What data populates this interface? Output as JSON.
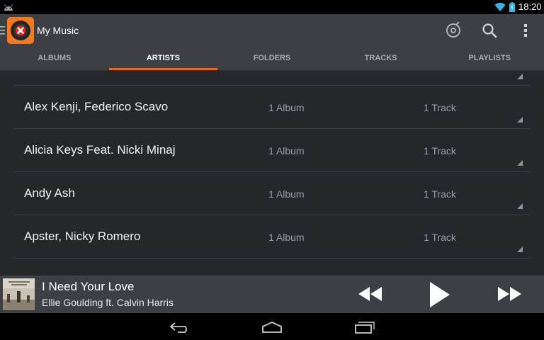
{
  "status_bar": {
    "time": "18:20"
  },
  "action_bar": {
    "title": "My Music"
  },
  "tabs": [
    {
      "label": "ALBUMS",
      "active": false
    },
    {
      "label": "ARTISTS",
      "active": true
    },
    {
      "label": "FOLDERS",
      "active": false
    },
    {
      "label": "TRACKS",
      "active": false
    },
    {
      "label": "PLAYLISTS",
      "active": false
    }
  ],
  "artists": [
    {
      "name": "Alex Kenji, Federico Scavo",
      "albums": "1 Album",
      "tracks": "1 Track"
    },
    {
      "name": "Alicia Keys Feat. Nicki Minaj",
      "albums": "1 Album",
      "tracks": "1 Track"
    },
    {
      "name": "Andy Ash",
      "albums": "1 Album",
      "tracks": "1 Track"
    },
    {
      "name": "Apster, Nicky Romero",
      "albums": "1 Album",
      "tracks": "1 Track"
    }
  ],
  "now_playing": {
    "title": "I Need Your Love",
    "artist": "Ellie Goulding ft. Calvin Harris"
  },
  "colors": {
    "accent": "#e8671b",
    "action_bar": "#3c3f44",
    "list_background": "#25272b"
  },
  "icons": {
    "action_bar": [
      "app-logo-icon",
      "cast-icon",
      "search-icon",
      "overflow-menu-icon"
    ],
    "playback": [
      "rewind-icon",
      "play-icon",
      "fast-forward-icon"
    ],
    "navigation": [
      "back-icon",
      "home-icon",
      "recent-apps-icon"
    ]
  }
}
